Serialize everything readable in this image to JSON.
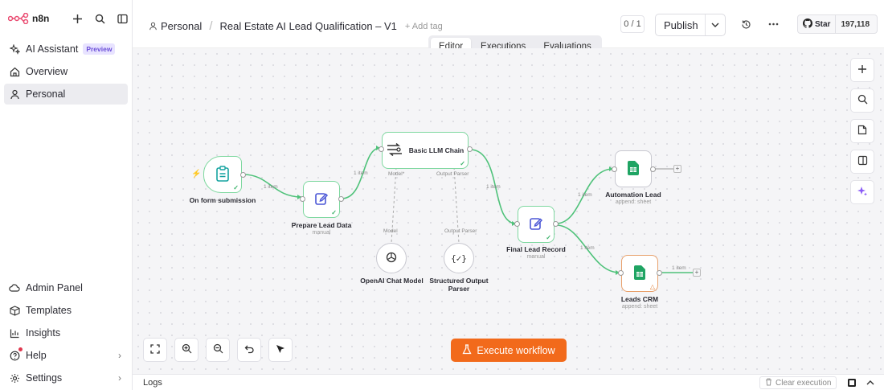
{
  "app": {
    "logo_text": "n8n"
  },
  "sidebar": {
    "items": [
      {
        "label": "AI Assistant",
        "badge": "Preview",
        "icon": "sparkles-icon"
      },
      {
        "label": "Overview",
        "icon": "home-icon"
      },
      {
        "label": "Personal",
        "icon": "user-icon"
      }
    ],
    "bottom_items": [
      {
        "label": "Admin Panel",
        "icon": "cloud-icon"
      },
      {
        "label": "Templates",
        "icon": "box-icon"
      },
      {
        "label": "Insights",
        "icon": "bar-chart-icon"
      },
      {
        "label": "Help",
        "icon": "help-icon"
      },
      {
        "label": "Settings",
        "icon": "gear-icon"
      }
    ]
  },
  "header": {
    "breadcrumb_project": "Personal",
    "breadcrumb_sep": "/",
    "workflow_title": "Real Estate AI Lead Qualification – V1",
    "add_tag": "+ Add tag",
    "counter": "0 / 1",
    "publish_label": "Publish",
    "github_star": "Star",
    "github_count": "197,118"
  },
  "tabs": [
    {
      "label": "Editor",
      "active": true
    },
    {
      "label": "Executions",
      "active": false
    },
    {
      "label": "Evaluations",
      "active": false
    }
  ],
  "nodes": {
    "form_trigger": {
      "label": "On form submission"
    },
    "prepare": {
      "label": "Prepare Lead Data",
      "sub": "manual"
    },
    "llm_chain": {
      "label": "Basic LLM Chain",
      "model_port": "Model*",
      "parser_port": "Output Parser"
    },
    "openai": {
      "label": "OpenAI Chat Model",
      "port": "Model"
    },
    "parser": {
      "label": "Structured Output Parser",
      "label_line1": "Structured Output",
      "label_line2": "Parser",
      "port": "Output Parser"
    },
    "final": {
      "label": "Final Lead Record",
      "sub": "manual"
    },
    "automation": {
      "label": "Automation Lead",
      "sub": "append: sheet"
    },
    "crm": {
      "label": "Leads CRM",
      "sub": "append: sheet"
    }
  },
  "edge_labels": {
    "e1": "1 item",
    "e2": "1 item",
    "e3": "1 item",
    "e4": "1 item",
    "e5": "1 item",
    "e6": "1 item"
  },
  "canvas": {
    "execute_label": "Execute workflow"
  },
  "logs": {
    "label": "Logs",
    "clear_label": "Clear execution"
  },
  "colors": {
    "accent": "#f26a1b",
    "success": "#3cb36a",
    "edge": "#4fc27a",
    "preview_badge": "#6b4fd8"
  }
}
